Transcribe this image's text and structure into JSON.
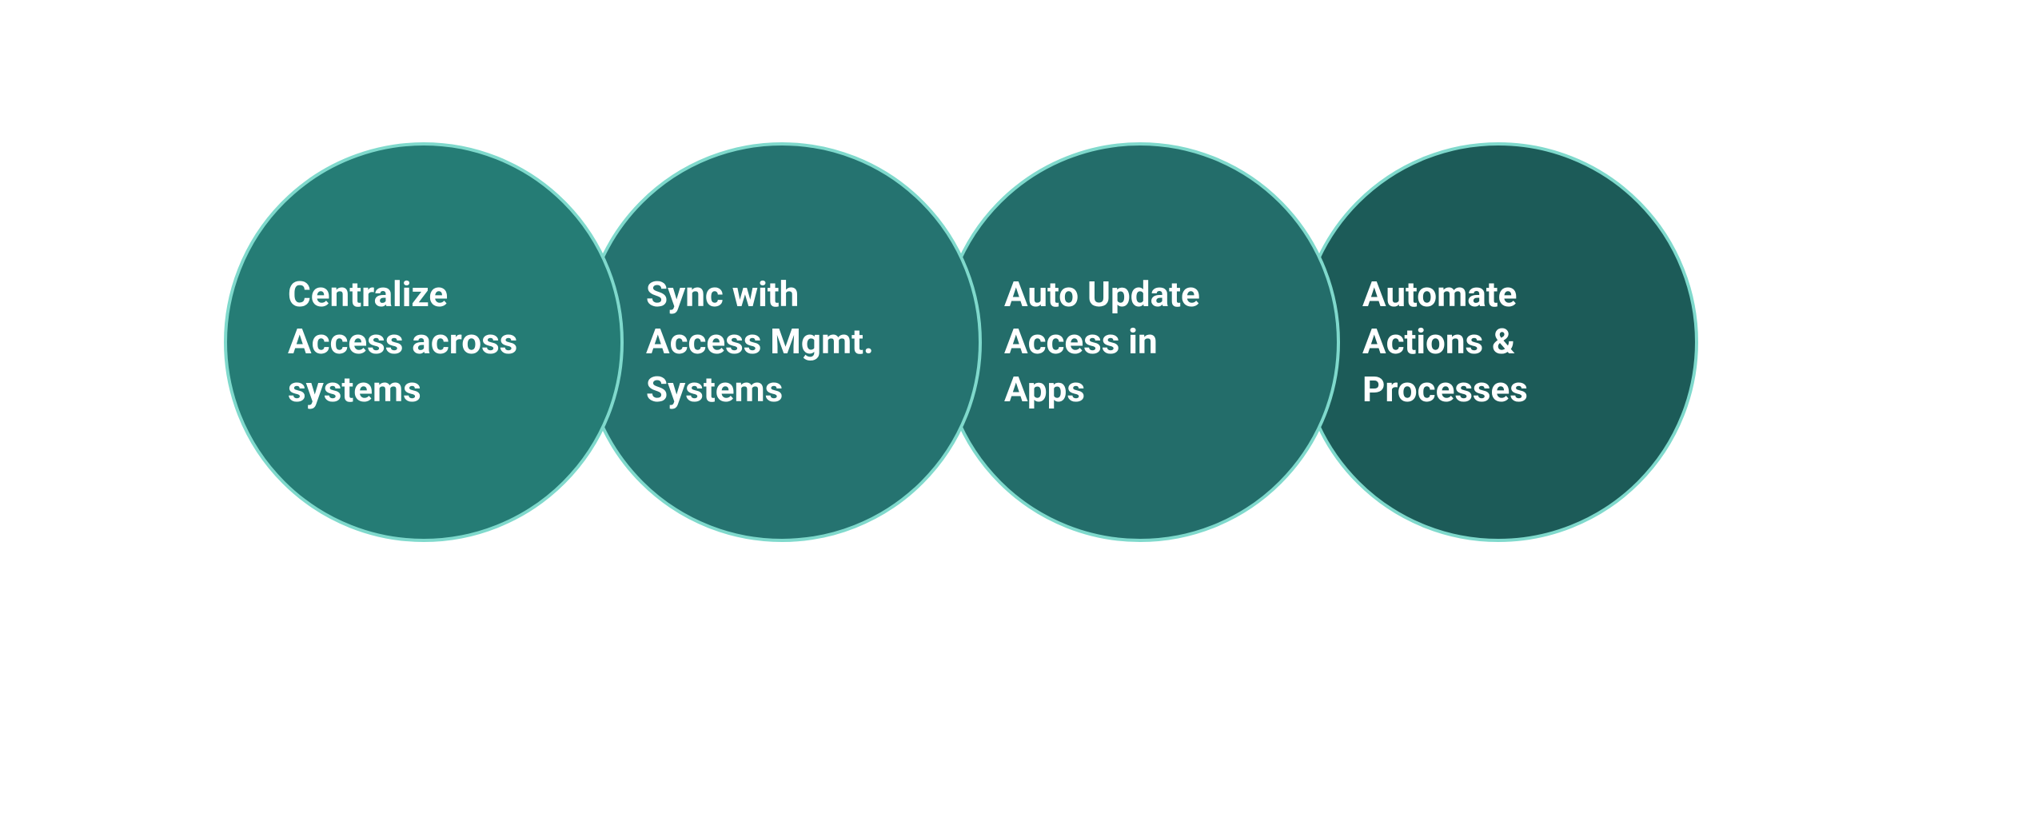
{
  "diagram": {
    "circles": [
      {
        "label": "Centralize\nAccess across\nsystems",
        "fill": "#257c75",
        "border": "#7fd9cc"
      },
      {
        "label": "Sync with\nAccess Mgmt.\nSystems",
        "fill": "#257370",
        "border": "#7fd9cc"
      },
      {
        "label": "Auto Update\nAccess in\nApps",
        "fill": "#236d6a",
        "border": "#7fd9cc"
      },
      {
        "label": "Automate\nActions &\nProcesses",
        "fill": "#1c5b58",
        "border": "#7fd9cc"
      }
    ]
  }
}
